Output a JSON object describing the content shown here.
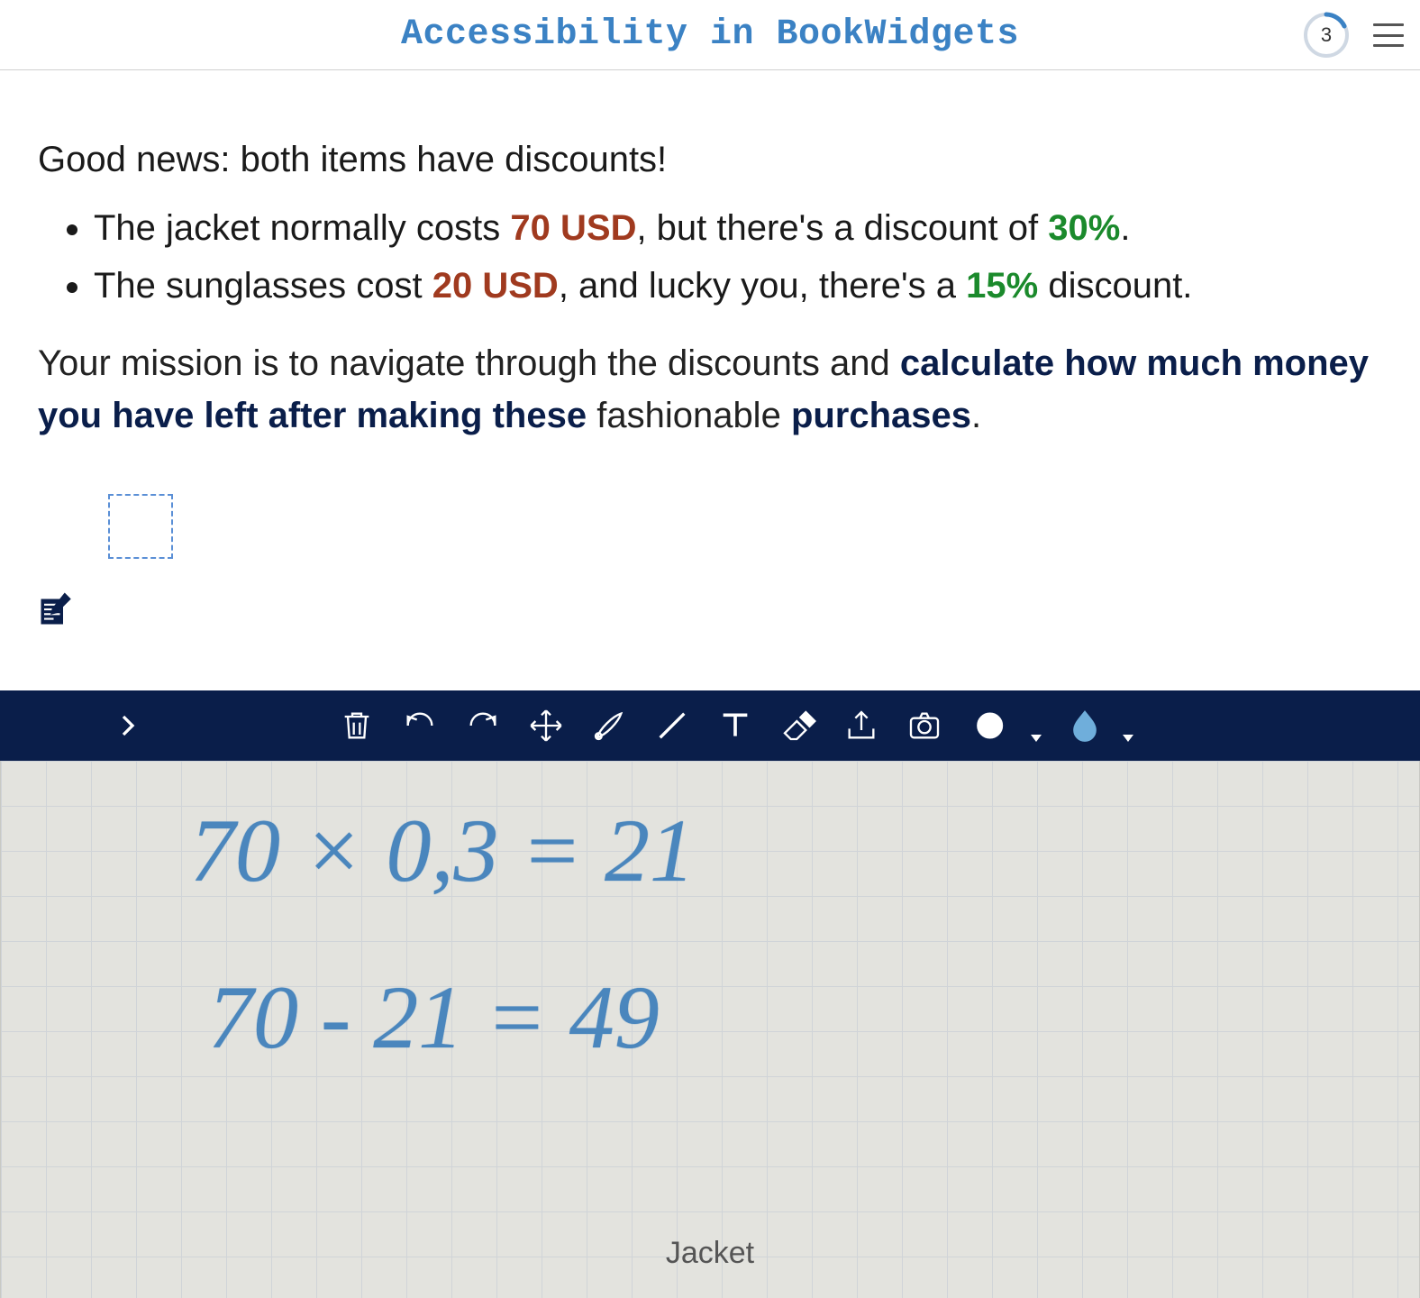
{
  "header": {
    "title": "Accessibility in BookWidgets",
    "progress_number": "3"
  },
  "content": {
    "intro": "Good news: both items have discounts!",
    "item1_prefix": "The jacket normally costs ",
    "item1_price": "70 USD",
    "item1_mid": ", but there's a discount of ",
    "item1_discount": "30%",
    "item1_suffix": ".",
    "item2_prefix": "The sunglasses cost ",
    "item2_price": "20 USD",
    "item2_mid": ", and lucky you, there's a ",
    "item2_discount": "15%",
    "item2_suffix": " discount.",
    "mission_prefix": "Your mission is to navigate through the discounts and ",
    "mission_bold1": "calculate how much money you have left after making these",
    "mission_plain": " fashionable ",
    "mission_bold2": "purchases",
    "mission_suffix": "."
  },
  "whiteboard": {
    "line1": "70 × 0,3 = 21",
    "line2": "70 - 21 = 49",
    "caption": "Jacket"
  }
}
